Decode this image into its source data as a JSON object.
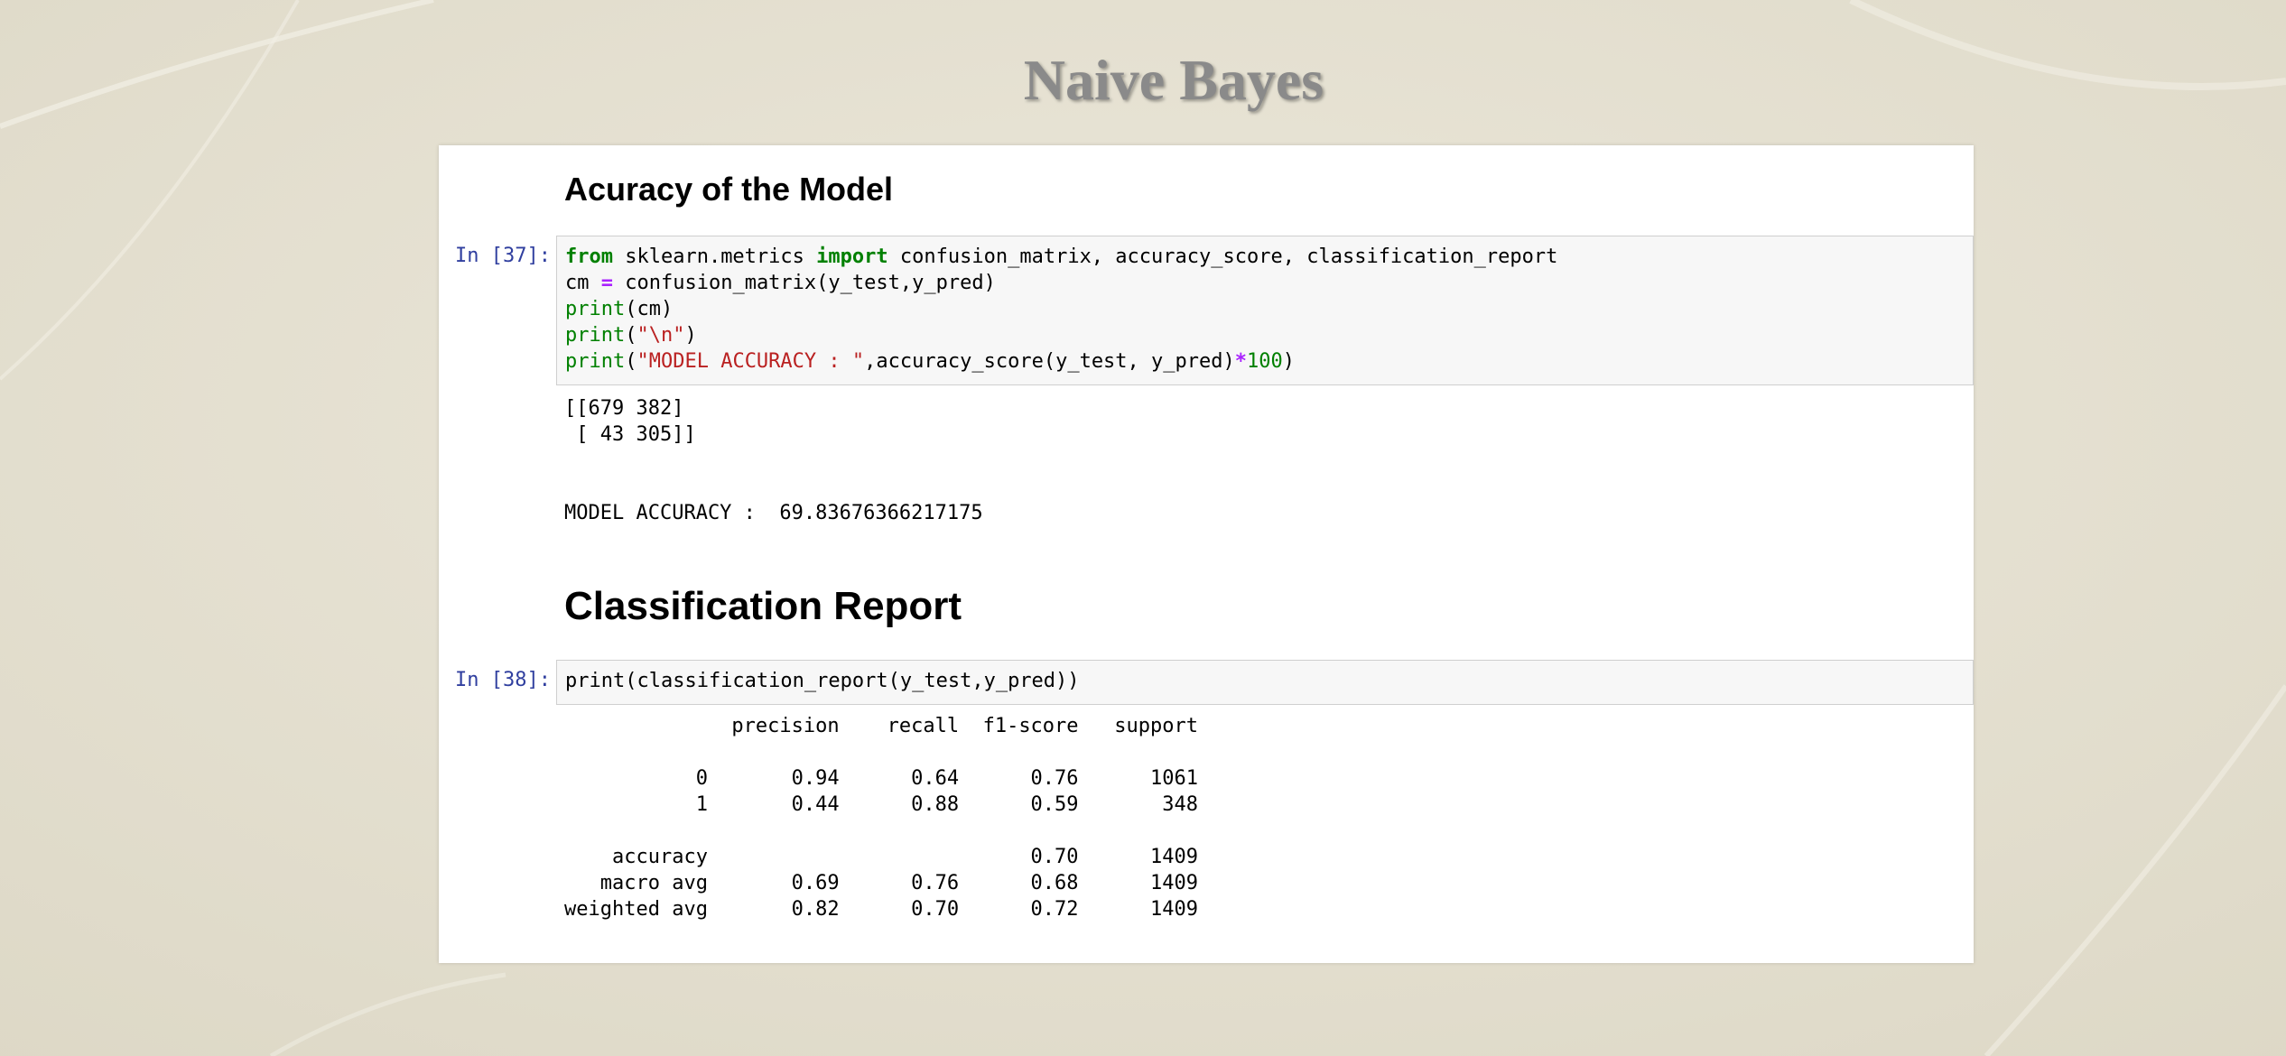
{
  "slide": {
    "title": "Naive Bayes"
  },
  "notebook": {
    "headings": {
      "accuracy": "Acuracy of the Model",
      "report": "Classification Report"
    },
    "cells": [
      {
        "prompt": "In [37]:",
        "code": {
          "line1": {
            "kw_from": "from",
            "module": " sklearn.metrics ",
            "kw_import": "import",
            "names": " confusion_matrix, accuracy_score, classification_report"
          },
          "line2": {
            "lhs": "cm ",
            "op": "=",
            "rhs": " confusion_matrix(y_test,y_pred)"
          },
          "line3": {
            "fn": "print",
            "args": "(cm)"
          },
          "line4": {
            "fn": "print",
            "open": "(",
            "str": "\"\\n\"",
            "close": ")"
          },
          "line5": {
            "fn": "print",
            "open": "(",
            "str": "\"MODEL ACCURACY : \"",
            "mid": ",accuracy_score(y_test, y_pred)",
            "op": "*",
            "num": "100",
            "close": ")"
          }
        },
        "output": "[[679 382]\n [ 43 305]]\n\n\nMODEL ACCURACY :  69.83676366217175"
      },
      {
        "prompt": "In [38]:",
        "code": {
          "line1": "print(classification_report(y_test,y_pred))"
        },
        "output": "              precision    recall  f1-score   support\n\n           0       0.94      0.64      0.76      1061\n           1       0.44      0.88      0.59       348\n\n    accuracy                           0.70      1409\n   macro avg       0.69      0.76      0.68      1409\nweighted avg       0.82      0.70      0.72      1409"
      }
    ]
  }
}
